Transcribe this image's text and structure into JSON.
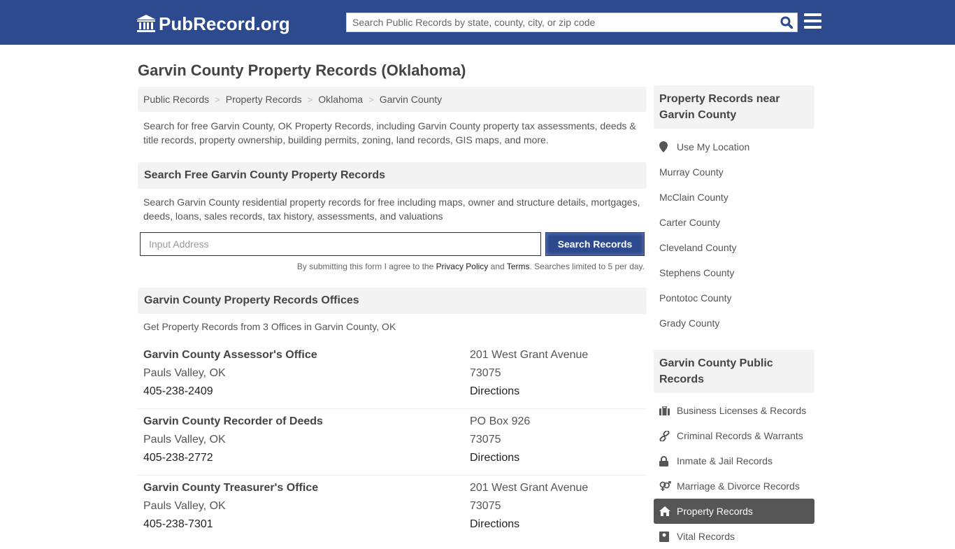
{
  "header": {
    "logo_text": "PubRecord.org",
    "search_placeholder": "Search Public Records by state, county, city, or zip code"
  },
  "page": {
    "title": "Garvin County Property Records (Oklahoma)",
    "breadcrumb": [
      "Public Records",
      "Property Records",
      "Oklahoma",
      "Garvin County"
    ],
    "intro": "Search for free Garvin County, OK Property Records, including Garvin County property tax assessments, deeds & title records, property ownership, building permits, zoning, land records, GIS maps, and more."
  },
  "search_section": {
    "heading": "Search Free Garvin County Property Records",
    "description": "Search Garvin County residential property records for free including maps, owner and structure details, mortgages, deeds, loans, sales records, tax history, assessments, and valuations",
    "input_placeholder": "Input Address",
    "button_label": "Search Records",
    "disclaimer_prefix": "By submitting this form I agree to the ",
    "privacy_link": "Privacy Policy",
    "and_text": " and ",
    "terms_link": "Terms",
    "disclaimer_suffix": ". Searches limited to 5 per day."
  },
  "offices_section": {
    "heading": "Garvin County Property Records Offices",
    "count_text": "Get Property Records from 3 Offices in Garvin County, OK",
    "offices": [
      {
        "name": "Garvin County Assessor's Office",
        "city": "Pauls Valley, OK",
        "phone": "405-238-2409",
        "address": "201 West Grant Avenue",
        "zip": "73075",
        "directions": "Directions"
      },
      {
        "name": "Garvin County Recorder of Deeds",
        "city": "Pauls Valley, OK",
        "phone": "405-238-2772",
        "address": "PO Box 926",
        "zip": "73075",
        "directions": "Directions"
      },
      {
        "name": "Garvin County Treasurer's Office",
        "city": "Pauls Valley, OK",
        "phone": "405-238-7301",
        "address": "201 West Grant Avenue",
        "zip": "73075",
        "directions": "Directions"
      }
    ]
  },
  "sidebar": {
    "nearby_heading": "Property Records near Garvin County",
    "use_location": "Use My Location",
    "nearby": [
      "Murray County",
      "McClain County",
      "Carter County",
      "Cleveland County",
      "Stephens County",
      "Pontotoc County",
      "Grady County"
    ],
    "public_heading": "Garvin County Public Records",
    "public_records": [
      {
        "label": "Business Licenses & Records",
        "icon": "briefcase-icon"
      },
      {
        "label": "Criminal Records & Warrants",
        "icon": "link-icon"
      },
      {
        "label": "Inmate & Jail Records",
        "icon": "lock-icon"
      },
      {
        "label": "Marriage & Divorce Records",
        "icon": "venus-mars-icon"
      },
      {
        "label": "Property Records",
        "icon": "home-icon",
        "active": true
      },
      {
        "label": "Vital Records",
        "icon": "id-card-icon"
      }
    ]
  }
}
